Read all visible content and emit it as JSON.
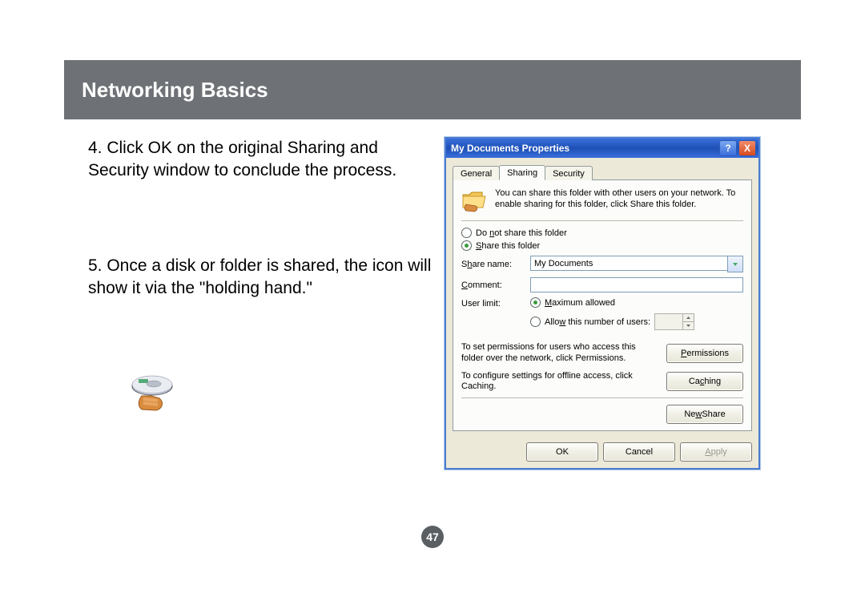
{
  "banner": {
    "title": "Networking Basics"
  },
  "instructions": {
    "step4": "4. Click OK on the original Sharing and Security window to conclude the process.",
    "step5": "5. Once a disk or folder is shared, the icon will show it via the \"holding hand.\""
  },
  "page_number": "47",
  "dialog": {
    "title": "My Documents Properties",
    "help_glyph": "?",
    "close_glyph": "X",
    "tabs": {
      "general": "General",
      "sharing": "Sharing",
      "security": "Security"
    },
    "intro": "You can share this folder with other users on your network.  To enable sharing for this folder, click Share this folder.",
    "radio_no_share_pre": "Do ",
    "radio_no_share_u": "n",
    "radio_no_share_post": "ot share this folder",
    "radio_share_u": "S",
    "radio_share_post": "hare this folder",
    "share_name_label_u": "h",
    "share_name_label_pre": "S",
    "share_name_label_post": "are name:",
    "share_name_value": "My Documents",
    "comment_label_u": "C",
    "comment_label_post": "omment:",
    "comment_value": "",
    "user_limit_label": "User limit:",
    "max_allowed_u": "M",
    "max_allowed_post": "aximum allowed",
    "allow_users_pre": "Allo",
    "allow_users_u": "w",
    "allow_users_post": " this number of users:",
    "perm_text": "To set permissions for users who access this folder over the network, click Permissions.",
    "perm_btn_u": "P",
    "perm_btn_post": "ermissions",
    "cache_text": "To configure settings for offline access, click Caching.",
    "cache_btn_pre": "Ca",
    "cache_btn_u": "c",
    "cache_btn_post": "hing",
    "newshare_btn_pre": "Ne",
    "newshare_btn_u": "w",
    "newshare_btn_post": " Share",
    "ok": "OK",
    "cancel": "Cancel",
    "apply_u": "A",
    "apply_post": "pply"
  }
}
